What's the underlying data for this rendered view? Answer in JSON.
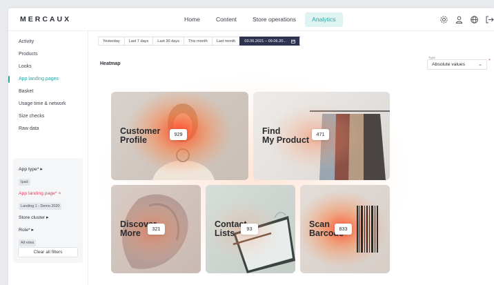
{
  "brand": "MERCAUX",
  "nav": [
    {
      "label": "Home",
      "active": false
    },
    {
      "label": "Content",
      "active": false
    },
    {
      "label": "Store operations",
      "active": false
    },
    {
      "label": "Analytics",
      "active": true
    }
  ],
  "top_icons": [
    "gear-icon",
    "user-icon",
    "globe-icon",
    "logout-icon"
  ],
  "sidebar": {
    "items": [
      {
        "label": "Activity",
        "active": false
      },
      {
        "label": "Products",
        "active": false
      },
      {
        "label": "Looks",
        "active": false
      },
      {
        "label": "App landing pages",
        "active": true
      },
      {
        "label": "Basket",
        "active": false
      },
      {
        "label": "Usage time & network",
        "active": false
      },
      {
        "label": "Size checks",
        "active": false
      },
      {
        "label": "Raw data",
        "active": false
      }
    ]
  },
  "filters": {
    "app_type_label": "App type* ▸",
    "app_type_value": "Ipad",
    "landing_label": "App landing page* ×",
    "landing_value": "Landing 1 - Demo 2020",
    "store_cluster_label": "Store cluster ▸",
    "role_label": "Role* ▸",
    "role_value": "All roles",
    "clear_label": "Clear all filters"
  },
  "date_range": {
    "buttons": [
      "Yesterday",
      "Last 7 days",
      "Last 30 days",
      "This month",
      "Last month"
    ],
    "custom": "03.06.2021 – 09.06.20...",
    "calendar_icon": "calendar-icon"
  },
  "heatmap": {
    "title": "Heatmap",
    "type_label": "Type",
    "type_value": "Absolute values",
    "tiles": [
      {
        "title_line1": "Customer",
        "title_line2": "Profile",
        "value": "929"
      },
      {
        "title_line1": "Find",
        "title_line2": "My Product",
        "value": "471"
      },
      {
        "title_line1": "Discover",
        "title_line2": "More",
        "value": "321"
      },
      {
        "title_line1": "Contact",
        "title_line2": "Lists",
        "value": "93"
      },
      {
        "title_line1": "Scan",
        "title_line2": "Barcode",
        "value": "833"
      }
    ]
  },
  "colors": {
    "accent": "#2aa6a3",
    "accent_bg": "#dff3f2",
    "date_active": "#2f3352",
    "filter_red": "#e2405b",
    "heat": "#ff6a2a"
  }
}
